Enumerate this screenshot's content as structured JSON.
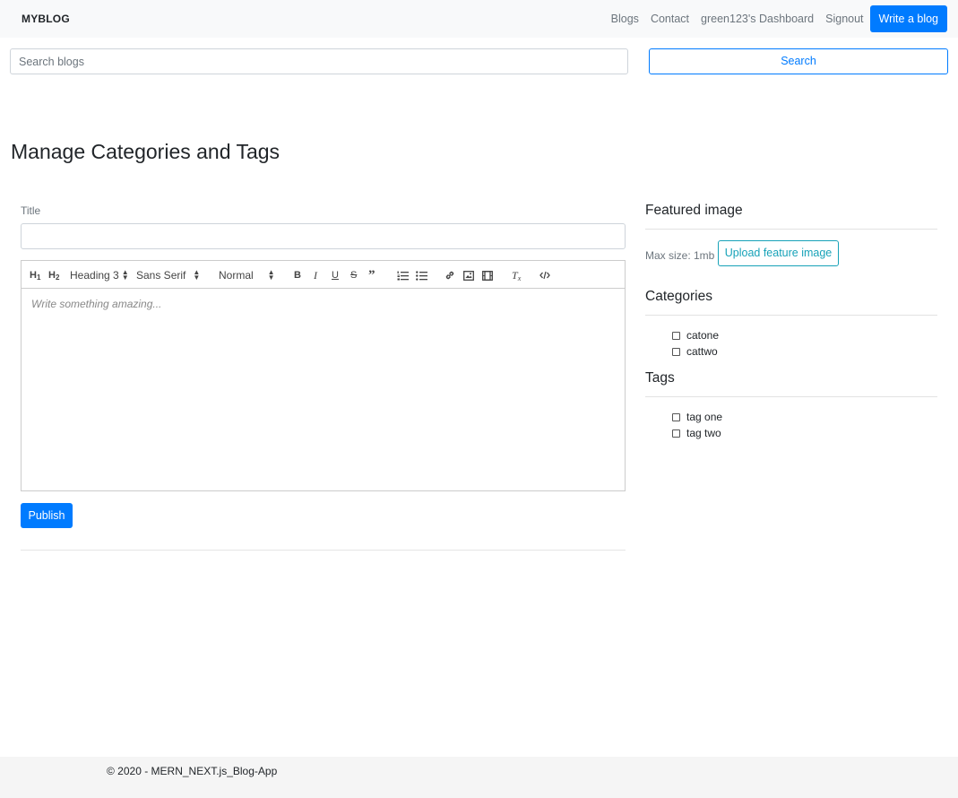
{
  "navbar": {
    "brand": "MYBLOG",
    "links": [
      "Blogs",
      "Contact",
      "green123's Dashboard",
      "Signout"
    ],
    "write_button": "Write a blog"
  },
  "search": {
    "placeholder": "Search blogs",
    "button": "Search"
  },
  "page_title": "Manage Categories and Tags",
  "form": {
    "title_label": "Title",
    "title_value": "",
    "editor": {
      "toolbar": {
        "h1": "H1",
        "h2": "H2",
        "header_select": "Heading 3",
        "font_select": "Sans Serif",
        "size_select": "Normal"
      },
      "placeholder": "Write something amazing..."
    },
    "publish_button": "Publish"
  },
  "sidebar": {
    "featured_heading": "Featured image",
    "max_size": "Max size: 1mb",
    "upload_button": "Upload feature image",
    "categories_heading": "Categories",
    "categories": [
      "catone",
      "cattwo"
    ],
    "tags_heading": "Tags",
    "tags": [
      "tag one",
      "tag two"
    ]
  },
  "footer": {
    "text": "© 2020 - MERN_NEXT.js_Blog-App"
  }
}
